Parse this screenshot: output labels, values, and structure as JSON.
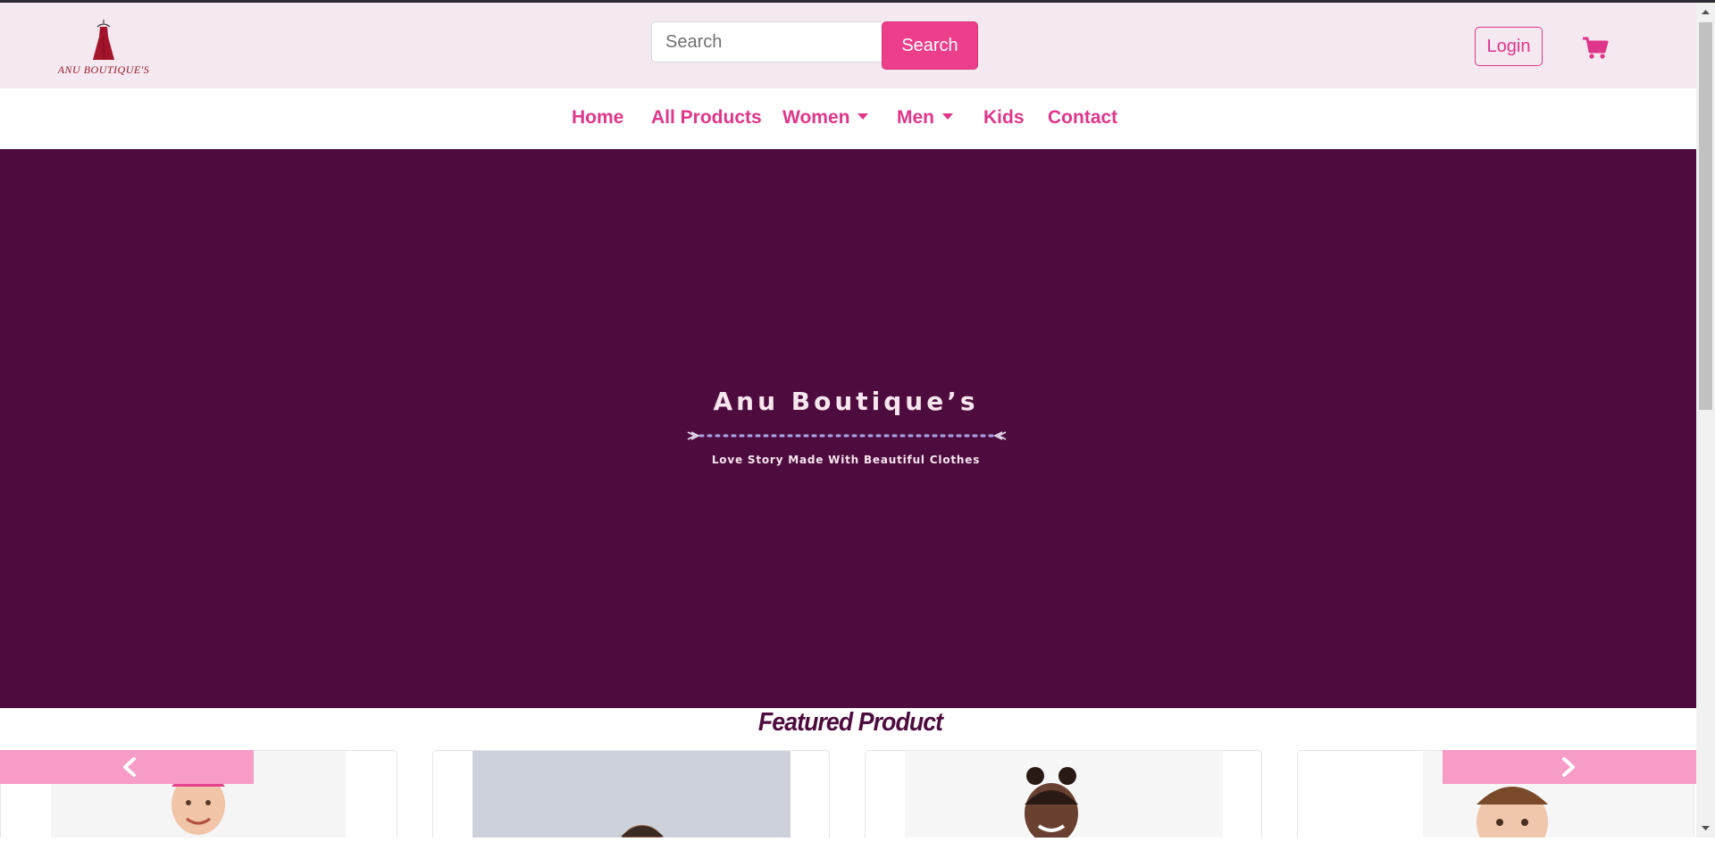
{
  "header": {
    "logo_text": "ANU BOUTIQUE'S",
    "search_placeholder": "Search",
    "search_button": "Search",
    "login_button": "Login",
    "cart_icon": "shopping-cart-icon"
  },
  "nav": {
    "items": [
      {
        "label": "Home"
      },
      {
        "label": "All Products"
      },
      {
        "label": "Women",
        "dropdown": true
      },
      {
        "label": "Men",
        "dropdown": true
      },
      {
        "label": "Kids"
      },
      {
        "label": "Contact"
      }
    ]
  },
  "hero": {
    "title": "Anu Boutique’s",
    "tagline": "Love Story Made With Beautiful Clothes"
  },
  "featured": {
    "title": "Featured Product",
    "prev_icon": "chevron-left-icon",
    "next_icon": "chevron-right-icon"
  },
  "colors": {
    "accent": "#e0368a",
    "header_bg": "#f4e8f1",
    "hero_bg": "#4e0c3e",
    "arrow_bg": "#f79bc7"
  }
}
